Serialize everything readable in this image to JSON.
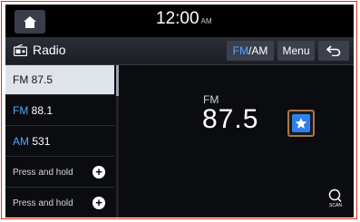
{
  "status": {
    "time": "12:00",
    "ampm": "AM"
  },
  "titlebar": {
    "title": "Radio",
    "fm": "FM",
    "am": "/AM",
    "menu": "Menu"
  },
  "presets": [
    {
      "band": "FM",
      "freq": "87.5"
    },
    {
      "band": "FM",
      "freq": "88.1"
    },
    {
      "band": "AM",
      "freq": "531"
    },
    {
      "text": "Press and hold"
    },
    {
      "text": "Press and hold"
    }
  ],
  "main": {
    "band": "FM",
    "frequency": "87.5"
  },
  "scan": {
    "label": "SCAN"
  },
  "colors": {
    "accent": "#4fa7ff",
    "favorite": "#2f80ed",
    "highlight_border": "#a87547",
    "frame": "#e0301e"
  },
  "icons": [
    "home-icon",
    "radio-icon",
    "back-arrow-icon",
    "star-icon",
    "plus-icon",
    "scan-icon"
  ]
}
